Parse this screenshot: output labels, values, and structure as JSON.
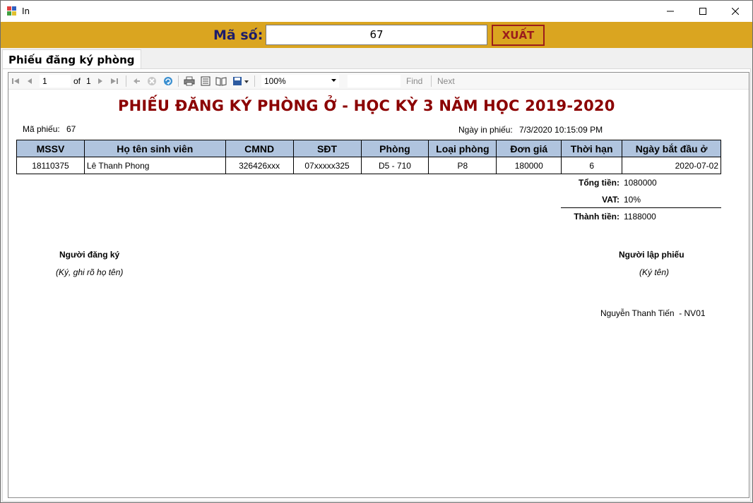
{
  "window": {
    "title": "In"
  },
  "topbar": {
    "ma_so_label": "Mã số:",
    "ma_so_value": "67",
    "xuat_label": "XUẤT"
  },
  "tab": {
    "label": "Phiếu đăng ký phòng"
  },
  "toolbar": {
    "page_value": "1",
    "of_label": "of",
    "total_pages": "1",
    "zoom": "100%",
    "find_label": "Find",
    "next_label": "Next"
  },
  "report": {
    "title": "PHIẾU ĐĂNG KÝ PHÒNG Ở - HỌC KỲ 3 NĂM HỌC 2019-2020",
    "ma_phieu_label": "Mã phiếu:",
    "ma_phieu_value": "67",
    "ngay_in_label": "Ngày in phiếu:",
    "ngay_in_value": "7/3/2020 10:15:09 PM",
    "columns": [
      "MSSV",
      "Họ tên sinh viên",
      "CMND",
      "SĐT",
      "Phòng",
      "Loại phòng",
      "Đơn giá",
      "Thời hạn",
      "Ngày bắt đầu ở"
    ],
    "rows": [
      [
        "18110375",
        "Lê Thanh Phong",
        "326426xxx",
        "07xxxxx325",
        "D5 - 710",
        "P8",
        "180000",
        "6",
        "2020-07-02"
      ]
    ],
    "tong_tien_label": "Tổng tiền:",
    "tong_tien_value": "1080000",
    "vat_label": "VAT:",
    "vat_value": "10%",
    "thanh_tien_label": "Thành tiền:",
    "thanh_tien_value": "1188000",
    "nguoi_dang_ky_label": "Người đăng ký",
    "nguoi_dang_ky_note": "(Ký, ghi rõ họ tên)",
    "nguoi_lap_label": "Người lập phiếu",
    "nguoi_lap_note": "(Ký tên)",
    "nguoi_lap_name": "Nguyễn Thanh Tiến  - NV01"
  },
  "colors": {
    "topbar": "#daa520",
    "title_red": "#8b0000",
    "header_blue": "#b0c4de",
    "xuat_border": "#9b1c1c"
  }
}
